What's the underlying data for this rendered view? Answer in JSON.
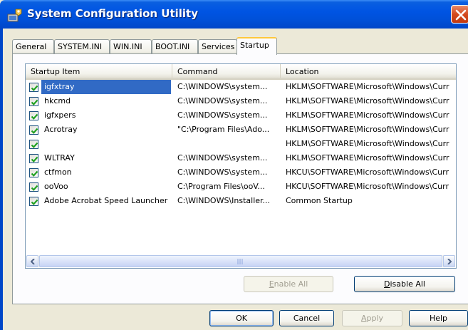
{
  "window": {
    "title": "System Configuration Utility"
  },
  "tabs": [
    {
      "label": "General"
    },
    {
      "label": "SYSTEM.INI"
    },
    {
      "label": "WIN.INI"
    },
    {
      "label": "BOOT.INI"
    },
    {
      "label": "Services"
    },
    {
      "label": "Startup",
      "active": true
    }
  ],
  "list": {
    "columns": [
      "Startup Item",
      "Command",
      "Location"
    ],
    "rows": [
      {
        "checked": true,
        "item": "igfxtray",
        "command": "C:\\WINDOWS\\system...",
        "location": "HKLM\\SOFTWARE\\Microsoft\\Windows\\Curr",
        "selected": true
      },
      {
        "checked": true,
        "item": "hkcmd",
        "command": "C:\\WINDOWS\\system...",
        "location": "HKLM\\SOFTWARE\\Microsoft\\Windows\\Curr"
      },
      {
        "checked": true,
        "item": "igfxpers",
        "command": "C:\\WINDOWS\\system...",
        "location": "HKLM\\SOFTWARE\\Microsoft\\Windows\\Curr"
      },
      {
        "checked": true,
        "item": "Acrotray",
        "command": "\"C:\\Program Files\\Ado...",
        "location": "HKLM\\SOFTWARE\\Microsoft\\Windows\\Curr"
      },
      {
        "checked": true,
        "item": "",
        "command": "",
        "location": "HKLM\\SOFTWARE\\Microsoft\\Windows\\Curr"
      },
      {
        "checked": true,
        "item": "WLTRAY",
        "command": "C:\\WINDOWS\\system...",
        "location": "HKLM\\SOFTWARE\\Microsoft\\Windows\\Curr"
      },
      {
        "checked": true,
        "item": "ctfmon",
        "command": "C:\\WINDOWS\\system...",
        "location": "HKCU\\SOFTWARE\\Microsoft\\Windows\\Curr"
      },
      {
        "checked": true,
        "item": "ooVoo",
        "command": "C:\\Program Files\\ooV...",
        "location": "HKCU\\SOFTWARE\\Microsoft\\Windows\\Curr"
      },
      {
        "checked": true,
        "item": "Adobe Acrobat Speed Launcher",
        "command": "C:\\WINDOWS\\Installer...",
        "location": "Common Startup"
      }
    ]
  },
  "buttons": {
    "enable_all": {
      "prefix": "",
      "accel": "E",
      "rest": "nable All"
    },
    "disable_all": {
      "prefix": "",
      "accel": "D",
      "rest": "isable All"
    },
    "ok": "OK",
    "cancel": "Cancel",
    "apply": {
      "prefix": "",
      "accel": "A",
      "rest": "pply"
    },
    "help": "Help"
  },
  "colors": {
    "titlebar": "#0054e3",
    "selection": "#316ac5",
    "close": "#d44a1e"
  },
  "icons": {
    "title": "msconfig-icon",
    "close": "close-icon",
    "check": "checkmark-icon"
  }
}
